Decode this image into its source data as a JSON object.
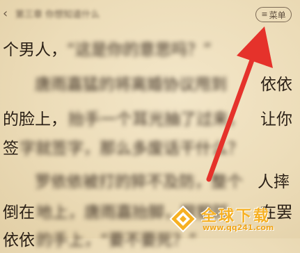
{
  "header": {
    "back_icon": "chevron-left-icon",
    "chapter_title": "第三章 你想知道什么",
    "menu_icon": "hamburger-icon",
    "menu_label": "菜单"
  },
  "reader": {
    "lines": [
      {
        "blur_before": "",
        "clear": "个男人，",
        "blur_after": "“这是你的意思吗？”"
      },
      {
        "blur_before": "　　唐雨嘉猛的将离婚协议甩到",
        "clear": "依依",
        "blur_after": ""
      },
      {
        "blur_before": "",
        "clear": "的脸上，",
        "blur_after": "抬手一个耳光抽了过来，",
        "clear2": "让你"
      },
      {
        "blur_before": "",
        "clear": "签",
        "blur_after": "字就签字，那么多废话干什么？"
      },
      {
        "blur_before": "　　罗依依被打的猝不及防，整个",
        "clear": "人摔",
        "blur_after": ""
      },
      {
        "blur_before": "",
        "clear": "倒在",
        "blur_after": "地上，唐雨嘉抬脚，狠狠踩",
        "clear2": "在罢"
      },
      {
        "blur_before": "",
        "clear": "依依",
        "blur_after": "的手上，“要不要死？”"
      }
    ]
  },
  "annotation": {
    "arrow_color": "#e5322b"
  },
  "watermark": {
    "brand": "全球下载",
    "url": "www.qq241.com",
    "brand_color": "#f6b022"
  }
}
